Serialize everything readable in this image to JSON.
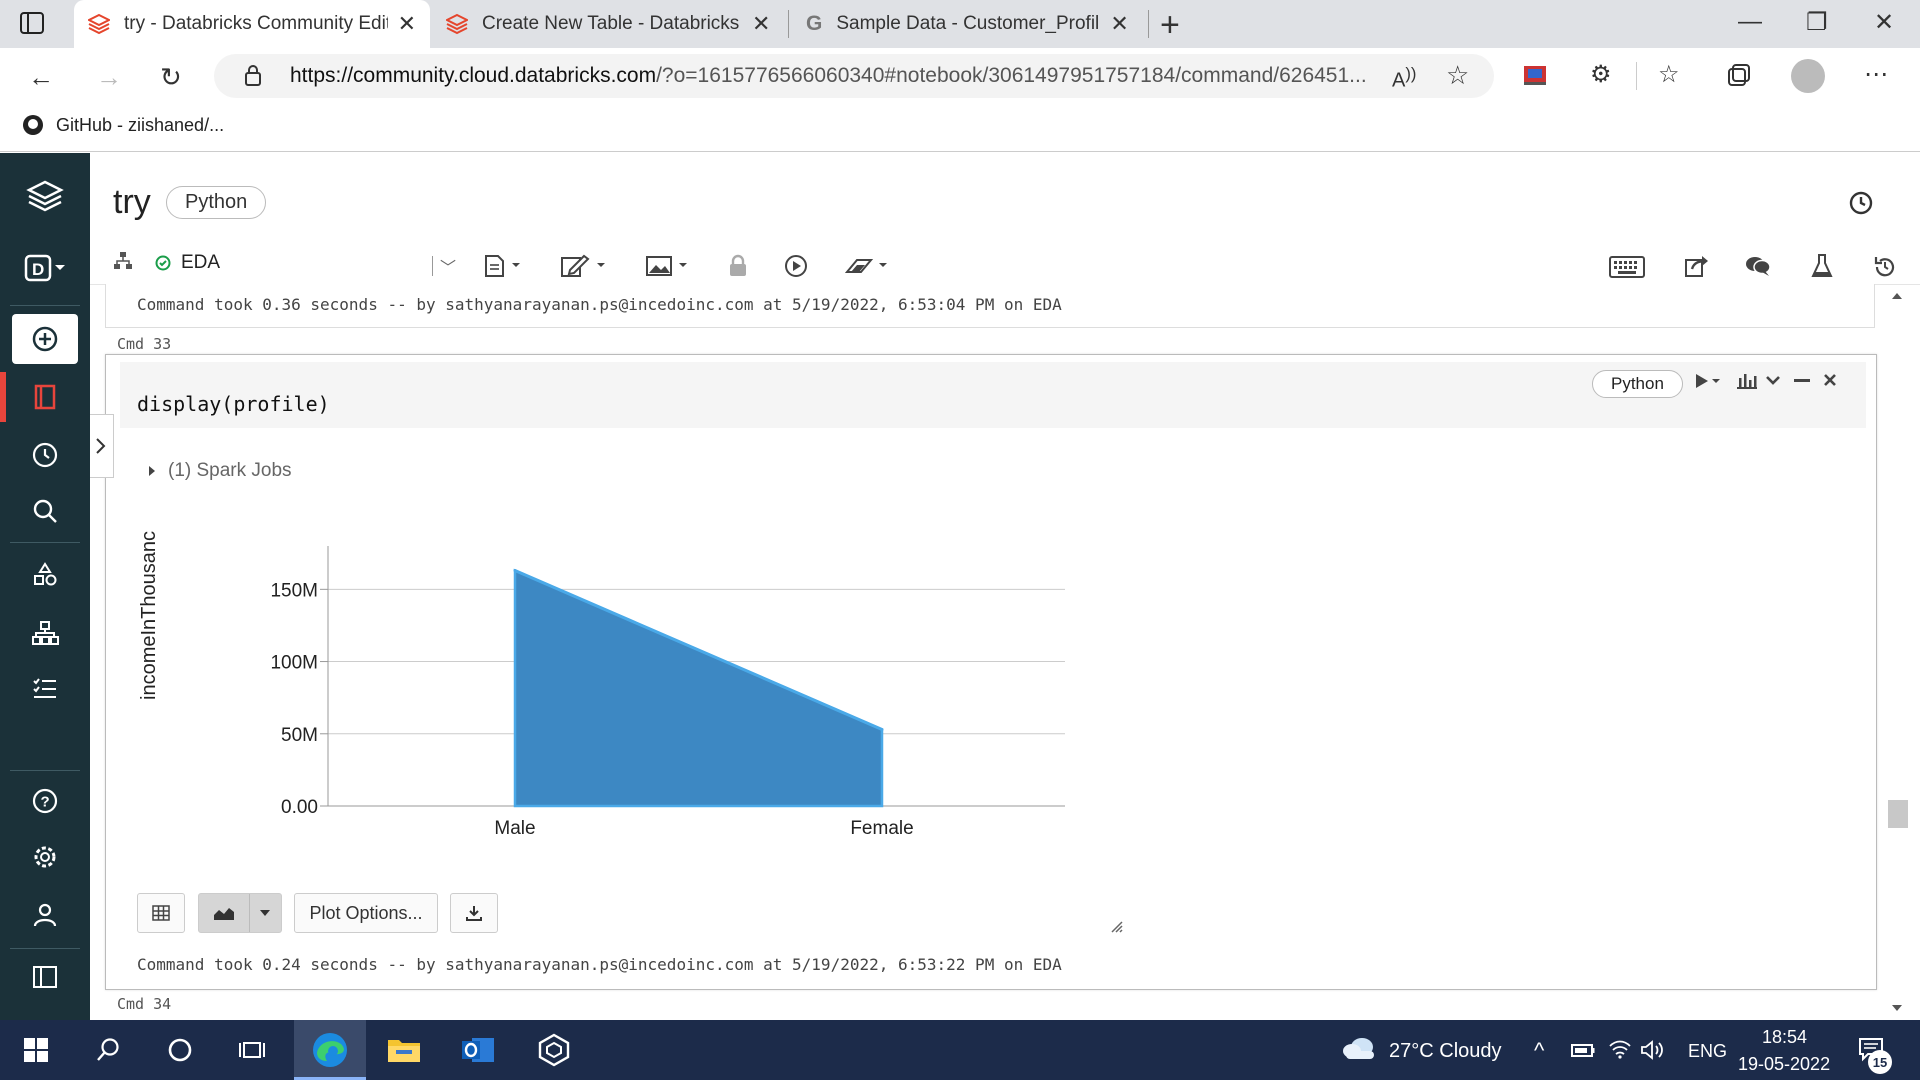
{
  "browser": {
    "tabs": [
      {
        "title": "try - Databricks Community Editi",
        "active": true
      },
      {
        "title": "Create New Table - Databricks C",
        "active": false
      },
      {
        "title": "Sample Data - Customer_Profile",
        "active": false
      }
    ],
    "url_domain": "https://community.cloud.databricks.com",
    "url_rest": "/?o=1615776566060340#notebook/3061497951757184/command/626451...",
    "bookmark": "GitHub - ziishaned/..."
  },
  "notebook": {
    "title": "try",
    "language": "Python",
    "cluster": "EDA"
  },
  "cells": {
    "prev_output": "Command took 0.36 seconds -- by sathyanarayanan.ps@incedoinc.com at 5/19/2022, 6:53:04 PM on EDA",
    "cmd33_label": "Cmd 33",
    "code": "display(profile)",
    "cell_language": "Python",
    "spark_jobs": "(1) Spark Jobs",
    "plot_options_label": "Plot Options...",
    "output": "Command took 0.24 seconds -- by sathyanarayanan.ps@incedoinc.com at 5/19/2022, 6:53:22 PM on EDA",
    "cmd34_label": "Cmd 34"
  },
  "chart_data": {
    "type": "area",
    "categories": [
      "Male",
      "Female"
    ],
    "values": [
      163000000,
      53000000
    ],
    "ylabel": "incomeInThousanc",
    "ylim": [
      0,
      180000000
    ],
    "yticks": [
      0,
      50000000,
      100000000,
      150000000
    ],
    "yticklabels": [
      "0.00",
      "50M",
      "100M",
      "150M"
    ],
    "color": "#3d88c3",
    "line_color": "#4aa9e8",
    "grid": true
  },
  "taskbar": {
    "weather": "27°C  Cloudy",
    "lang": "ENG",
    "time": "18:54",
    "date": "19-05-2022",
    "notifications": "15"
  }
}
